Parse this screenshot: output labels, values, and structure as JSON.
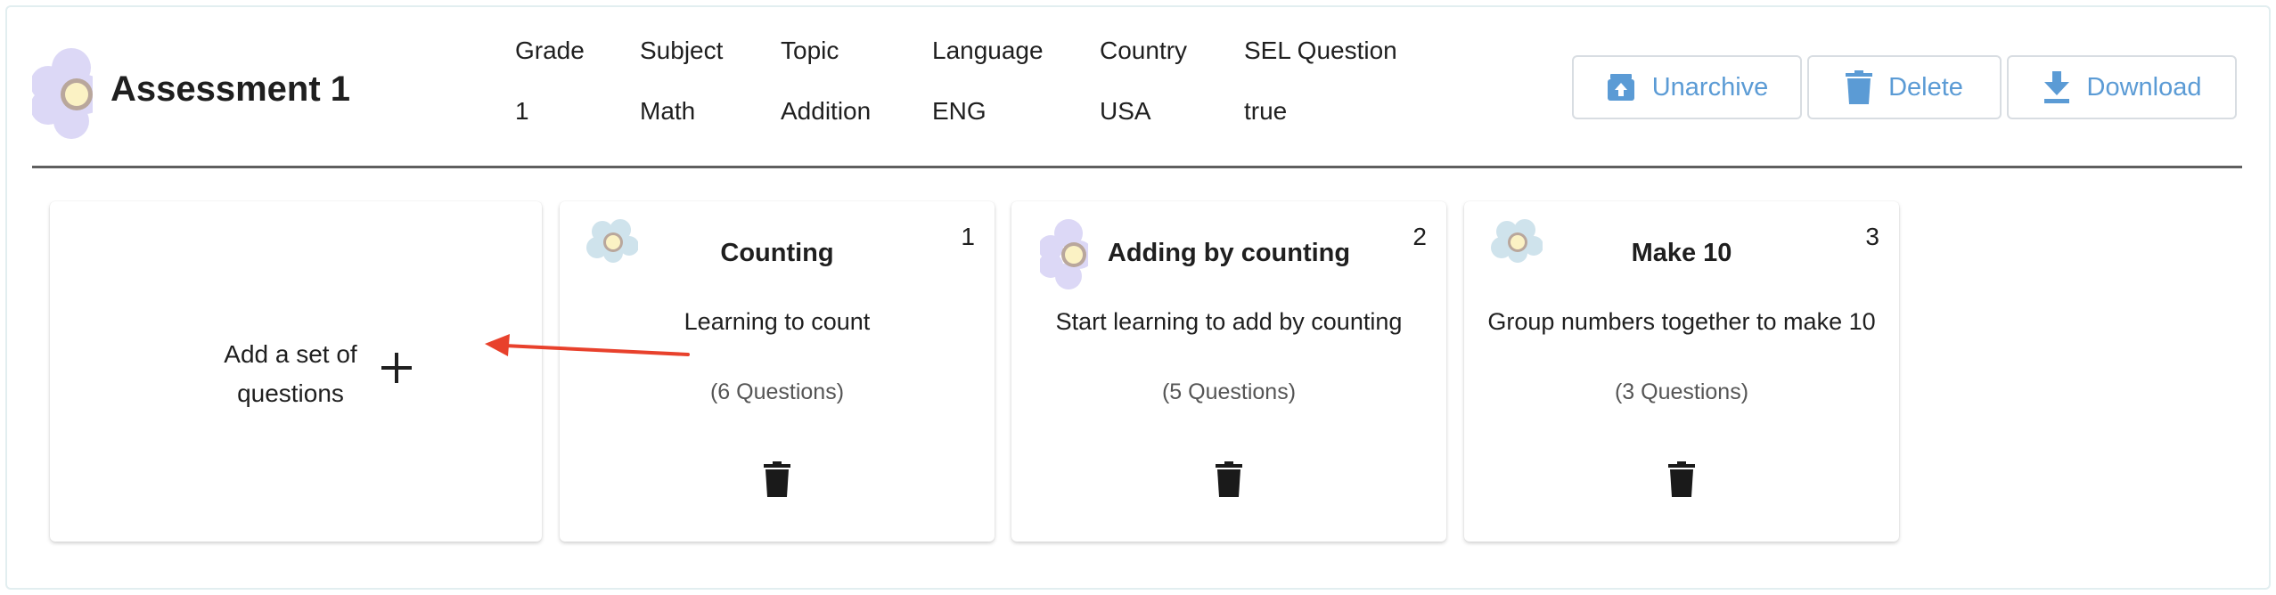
{
  "assessment": {
    "title": "Assessment 1",
    "logo_icon": "flower-logo-icon",
    "meta": [
      {
        "label": "Grade",
        "value": "1"
      },
      {
        "label": "Subject",
        "value": "Math"
      },
      {
        "label": "Topic",
        "value": "Addition"
      },
      {
        "label": "Language",
        "value": "ENG"
      },
      {
        "label": "Country",
        "value": "USA"
      },
      {
        "label": "SEL Question",
        "value": "true"
      }
    ]
  },
  "actions": {
    "unarchive": {
      "label": "Unarchive",
      "icon": "unarchive-icon"
    },
    "delete": {
      "label": "Delete",
      "icon": "trash-icon"
    },
    "download": {
      "label": "Download",
      "icon": "download-icon"
    }
  },
  "add_set": {
    "line1": "Add a set of",
    "line2": "questions",
    "icon": "plus-icon"
  },
  "question_sets": [
    {
      "number": "1",
      "title": "Counting",
      "description": "Learning to count",
      "count": "(6 Questions)",
      "logo_color": "#cfe3ec"
    },
    {
      "number": "2",
      "title": "Adding by counting",
      "description": "Start learning to add by counting",
      "count": "(5 Questions)",
      "logo_color": "#d9d5f4"
    },
    {
      "number": "3",
      "title": "Make 10",
      "description": "Group numbers together to make 10",
      "count": "(3 Questions)",
      "logo_color": "#cfe3ec"
    }
  ],
  "colors": {
    "accent": "#5b9bd5",
    "annotation_arrow": "#e8412c",
    "divider": "#5f5f5f"
  }
}
